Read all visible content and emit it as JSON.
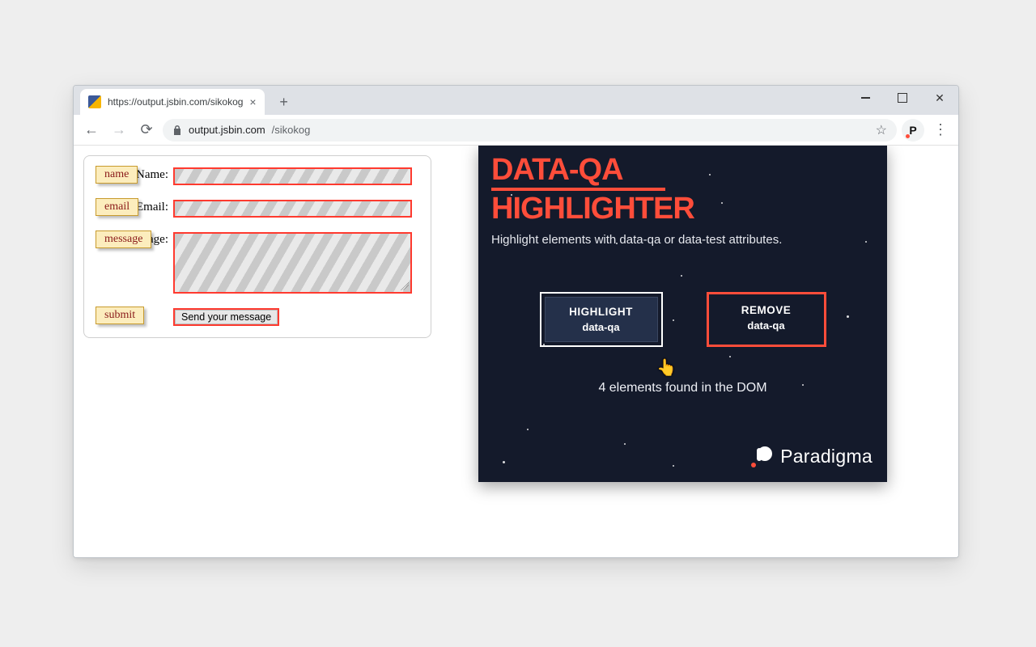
{
  "browser": {
    "tab_title": "https://output.jsbin.com/sikokog",
    "url_host": "output.jsbin.com",
    "url_path": "/sikokog"
  },
  "win_controls": {
    "minimize": "–",
    "maximize": "▢",
    "close": "✕"
  },
  "form": {
    "rows": [
      {
        "qa": "name",
        "label": "Name:"
      },
      {
        "qa": "email",
        "label": "Email:"
      },
      {
        "qa": "message",
        "label": "Message:"
      }
    ],
    "submit_qa": "submit",
    "submit_label": "Send your message"
  },
  "ext": {
    "title_line1": "DATA-QA",
    "title_line2": "HIGHLIGHTER",
    "subtitle": "Highlight elements with data-qa or data-test attributes.",
    "btn_highlight_title": "HIGHLIGHT",
    "btn_highlight_sub": "data-qa",
    "btn_remove_title": "REMOVE",
    "btn_remove_sub": "data-qa",
    "status": "4 elements found in the DOM",
    "brand": "Paradigma"
  }
}
